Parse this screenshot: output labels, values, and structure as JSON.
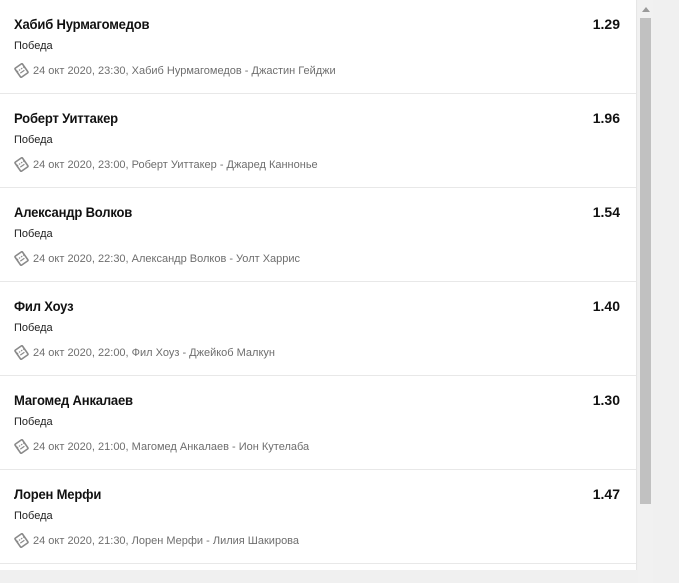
{
  "bets": [
    {
      "name": "Хабиб Нурмагомедов",
      "odds": "1.29",
      "market": "Победа",
      "event": "24 окт 2020, 23:30, Хабиб Нурмагомедов - Джастин Гейджи"
    },
    {
      "name": "Роберт Уиттакер",
      "odds": "1.96",
      "market": "Победа",
      "event": "24 окт 2020, 23:00, Роберт Уиттакер - Джаред Канноньe"
    },
    {
      "name": "Александр Волков",
      "odds": "1.54",
      "market": "Победа",
      "event": "24 окт 2020, 22:30, Александр Волков - Уолт Харрис"
    },
    {
      "name": "Фил Хоуз",
      "odds": "1.40",
      "market": "Победа",
      "event": "24 окт 2020, 22:00, Фил Хоуз - Джейкоб Малкун"
    },
    {
      "name": "Магомед Анкалаев",
      "odds": "1.30",
      "market": "Победа",
      "event": "24 окт 2020, 21:00, Магомед Анкалаев - Ион Кутелаба"
    },
    {
      "name": "Лорен Мерфи",
      "odds": "1.47",
      "market": "Победа",
      "event": "24 окт 2020, 21:30, Лорен Мерфи - Лилия Шакирова"
    }
  ],
  "icons": {
    "event": "ticket-icon",
    "scroll_up": "scroll-up-arrow-icon"
  }
}
